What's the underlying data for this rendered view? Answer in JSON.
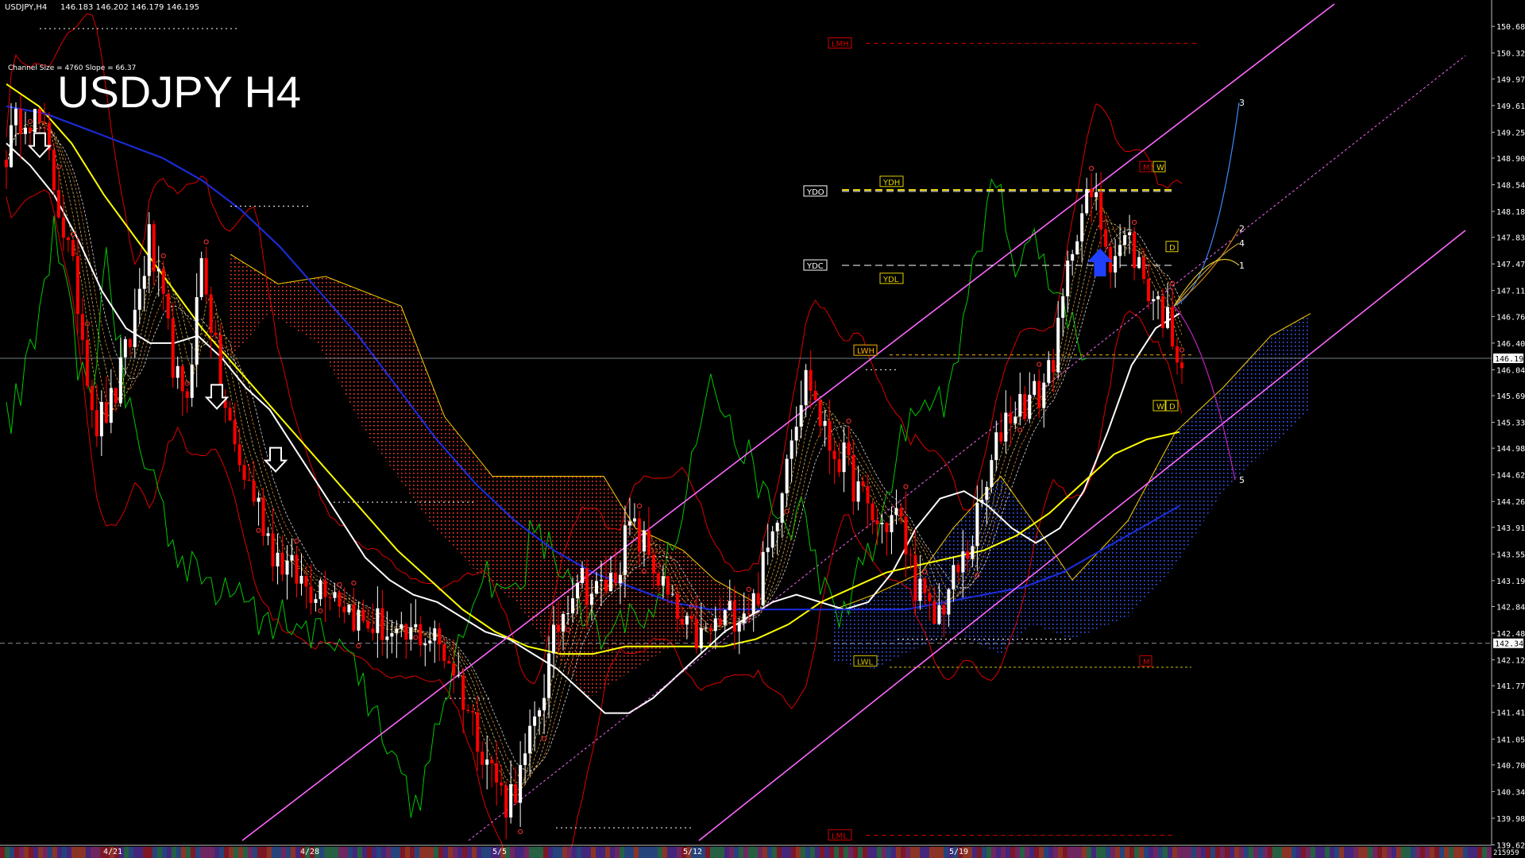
{
  "header": {
    "symbol_line": "USDJPY,H4",
    "ohlc": "146.183 146.202 146.179 146.195",
    "channel_info": "Channel Size = 4760 Slope = 66.37",
    "big_title": "USDJPY H4"
  },
  "footer": {
    "bars_count": "215959"
  },
  "colors": {
    "background": "#000000",
    "bull": "#ffffff",
    "bear": "#ff0000",
    "ma_white": "#ffffff",
    "ma_yellow": "#ffff00",
    "ma_blue": "#1a2bd6",
    "channel": "#ff66ff",
    "kumo_bear": "#ff3b2b",
    "kumo_bull": "#3a5bff",
    "chikou": "#00c800",
    "bands": "#dd0000"
  },
  "chart_data": {
    "type": "candlestick",
    "symbol": "USDJPY",
    "timeframe": "H4",
    "ylim": [
      139.625,
      150.875
    ],
    "y_ticks": [
      150.68,
      150.32,
      149.97,
      149.61,
      149.25,
      148.9,
      148.54,
      148.18,
      147.83,
      147.47,
      147.11,
      146.76,
      146.4,
      146.04,
      145.69,
      145.33,
      144.98,
      144.62,
      144.26,
      143.91,
      143.55,
      143.19,
      142.84,
      142.48,
      142.12,
      141.77,
      141.41,
      141.05,
      140.7,
      140.34,
      139.98,
      139.62
    ],
    "y_tick_labels": [
      "150.680",
      "150.320",
      "149.970",
      "149.610",
      "149.250",
      "148.900",
      "148.540",
      "148.180",
      "147.830",
      "147.470",
      "147.110",
      "146.760",
      "146.400",
      "146.040",
      "145.690",
      "145.330",
      "144.980",
      "144.620",
      "144.260",
      "143.910",
      "143.550",
      "143.190",
      "142.840",
      "142.480",
      "142.120",
      "141.770",
      "141.410",
      "141.050",
      "140.700",
      "140.340",
      "139.980",
      "139.620"
    ],
    "x_labels": [
      "4/21",
      "4/28",
      "5/5",
      "5/12",
      "5/19"
    ],
    "current_price": 146.195,
    "current_price_label": "146.195",
    "secondary_price_label": "142.344",
    "secondary_price": 142.344,
    "close_path": [
      149.0,
      149.6,
      149.3,
      148.2,
      147.0,
      145.3,
      145.6,
      146.5,
      147.8,
      146.6,
      145.4,
      147.6,
      145.8,
      144.8,
      144.3,
      143.6,
      143.3,
      143.1,
      143.2,
      142.9,
      142.6,
      142.6,
      142.3,
      142.5,
      142.4,
      142.1,
      141.4,
      140.8,
      140.2,
      140.6,
      141.6,
      142.6,
      143.3,
      143.0,
      143.2,
      143.9,
      143.6,
      143.0,
      142.5,
      142.4,
      142.6,
      142.8,
      142.9,
      143.8,
      145.2,
      146.0,
      145.1,
      144.8,
      144.3,
      143.9,
      144.1,
      143.2,
      142.6,
      143.1,
      143.6,
      144.4,
      145.4,
      145.6,
      145.7,
      146.4,
      148.0,
      148.4,
      147.6,
      147.8,
      147.2,
      146.8,
      146.2
    ],
    "series": [
      {
        "name": "MA",
        "color": "#ffffff",
        "values": [
          149.1,
          148.8,
          148.4,
          147.8,
          147.1,
          146.6,
          146.4,
          146.4,
          146.5,
          146.2,
          145.8,
          145.5,
          145.0,
          144.5,
          144.0,
          143.5,
          143.2,
          143.0,
          142.9,
          142.7,
          142.5,
          142.4,
          142.2,
          142.0,
          141.7,
          141.4,
          141.4,
          141.6,
          141.9,
          142.2,
          142.5,
          142.7,
          142.9,
          143.0,
          142.9,
          142.8,
          142.9,
          143.3,
          143.9,
          144.3,
          144.4,
          144.2,
          143.9,
          143.7,
          143.9,
          144.4,
          145.2,
          146.1,
          146.6,
          146.8
        ]
      },
      {
        "name": "MA",
        "color": "#ffff00",
        "values": [
          149.9,
          149.6,
          149.1,
          148.4,
          147.8,
          147.2,
          146.6,
          146.1,
          145.6,
          145.1,
          144.6,
          144.1,
          143.6,
          143.2,
          142.8,
          142.5,
          142.3,
          142.2,
          142.2,
          142.3,
          142.3,
          142.3,
          142.3,
          142.4,
          142.6,
          142.9,
          143.1,
          143.3,
          143.4,
          143.5,
          143.6,
          143.8,
          144.1,
          144.5,
          144.9,
          145.1,
          145.2
        ]
      },
      {
        "name": "MA",
        "color": "#1a2bd6",
        "values": [
          149.6,
          149.5,
          149.3,
          149.1,
          148.9,
          148.6,
          148.2,
          147.7,
          147.1,
          146.5,
          145.8,
          145.1,
          144.5,
          144.0,
          143.6,
          143.3,
          143.1,
          142.9,
          142.8,
          142.8,
          142.8,
          142.8,
          142.8,
          142.8,
          142.9,
          143.0,
          143.1,
          143.3,
          143.6,
          143.9,
          144.2
        ]
      }
    ],
    "annotations": [
      "LMH",
      "LML",
      "YDO",
      "YDH",
      "YDC",
      "YDL",
      "LWH",
      "LWL",
      "M",
      "W",
      "D",
      "1",
      "2",
      "3",
      "4",
      "5"
    ]
  }
}
